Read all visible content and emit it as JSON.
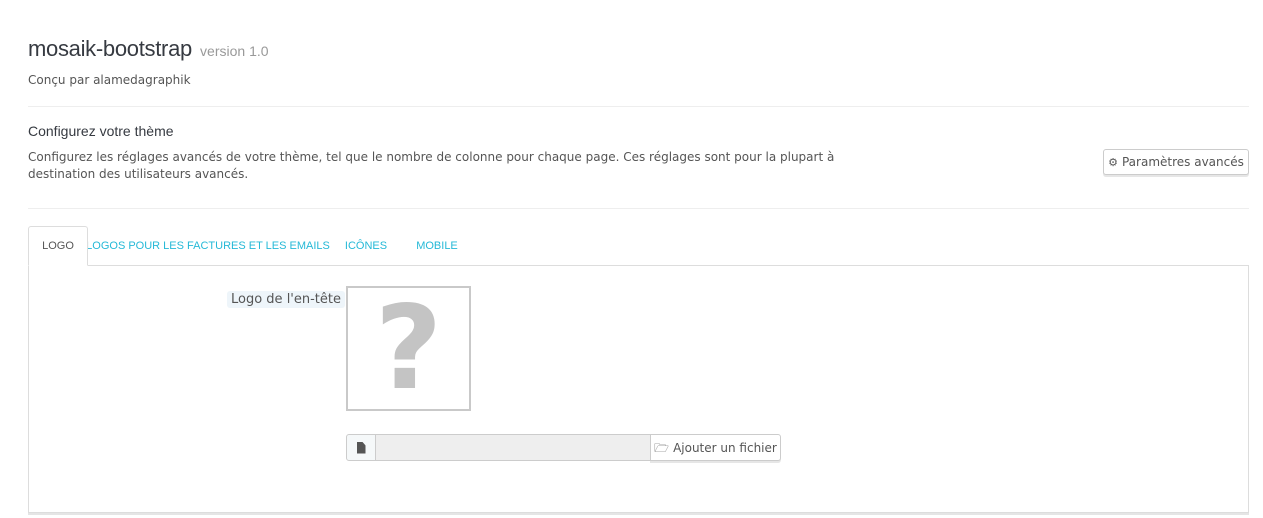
{
  "theme": {
    "name": "mosaik-bootstrap",
    "version": "version 1.0",
    "author": "Conçu par alamedagraphik"
  },
  "configure": {
    "heading": "Configurez votre thème",
    "description": "Configurez les réglages avancés de votre thème, tel que le nombre de colonne pour chaque page. Ces réglages sont pour la plupart à destination des utilisateurs avancés.",
    "advanced_button": {
      "label": "Paramètres avancés",
      "icon": "gear-icon"
    }
  },
  "tabs": [
    {
      "label": "LOGO",
      "active": true
    },
    {
      "label": "LOGOS POUR LES FACTURES ET LES EMAILS",
      "active": false
    },
    {
      "label": "ICÔNES",
      "active": false
    },
    {
      "label": "MOBILE",
      "active": false
    }
  ],
  "logo_panel": {
    "field_label": "Logo de l'en-tête",
    "preview_icon": "question-mark-placeholder",
    "preview_glyph": "?",
    "file_input": {
      "value": "",
      "addon_icon": "file-icon",
      "button_label": "Ajouter un fichier",
      "button_icon": "folder-open-icon"
    }
  },
  "colors": {
    "accent": "#25b9d7",
    "text": "#555555",
    "heading": "#363a41",
    "border": "#dddddd",
    "label_highlight": "#eef5fa"
  }
}
